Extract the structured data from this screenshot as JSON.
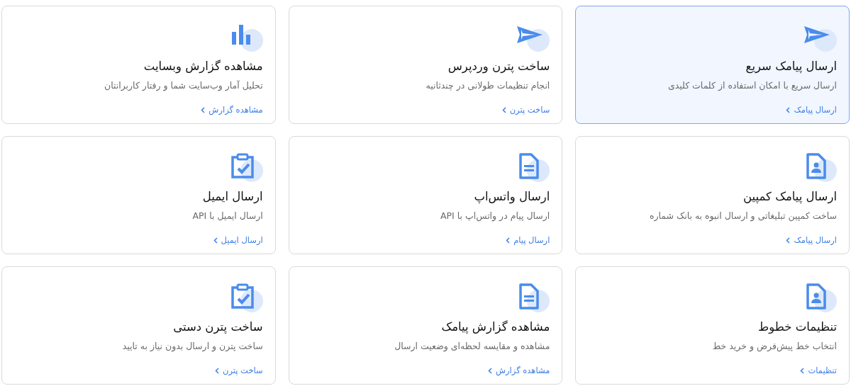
{
  "cards": [
    {
      "kind": "send",
      "title": "ارسال پیامک سریع",
      "description": "ارسال سریع با امکان استفاده از کلمات کلیدی",
      "link": "ارسال پیامک",
      "selected": true
    },
    {
      "kind": "send",
      "title": "ساخت پترن وردپرس",
      "description": "انجام تنظیمات طولانی در چندثانیه",
      "link": "ساخت پترن",
      "selected": false
    },
    {
      "kind": "chart",
      "title": "مشاهده گزارش وبسایت",
      "description": "تحلیل آمار وب‌سایت شما و رفتار کاربرانتان",
      "link": "مشاهده گزارش",
      "selected": false
    },
    {
      "kind": "contact",
      "title": "ارسال پیامک کمپین",
      "description": "ساخت کمپین تبلیغاتی و ارسال انبوه به بانک شماره",
      "link": "ارسال پیامک",
      "selected": false
    },
    {
      "kind": "document",
      "title": "ارسال واتس‌اپ",
      "description": "ارسال پیام در واتس‌اپ با API",
      "link": "ارسال پیام",
      "selected": false
    },
    {
      "kind": "clipboard",
      "title": "ارسال ایمیل",
      "description": "ارسال ایمیل با API",
      "link": "ارسال ایمیل",
      "selected": false
    },
    {
      "kind": "contact",
      "title": "تنظیمات خطوط",
      "description": "انتخاب خط پیش‌فرض و خرید خط",
      "link": "تنظیمات",
      "selected": false
    },
    {
      "kind": "document",
      "title": "مشاهده گزارش پیامک",
      "description": "مشاهده و مقایسه لحظه‌ای وضعیت ارسال",
      "link": "مشاهده گزارش",
      "selected": false
    },
    {
      "kind": "clipboard",
      "title": "ساخت پترن دستی",
      "description": "ساخت پترن و ارسال بدون نیاز به تایید",
      "link": "ساخت پترن",
      "selected": false
    }
  ]
}
